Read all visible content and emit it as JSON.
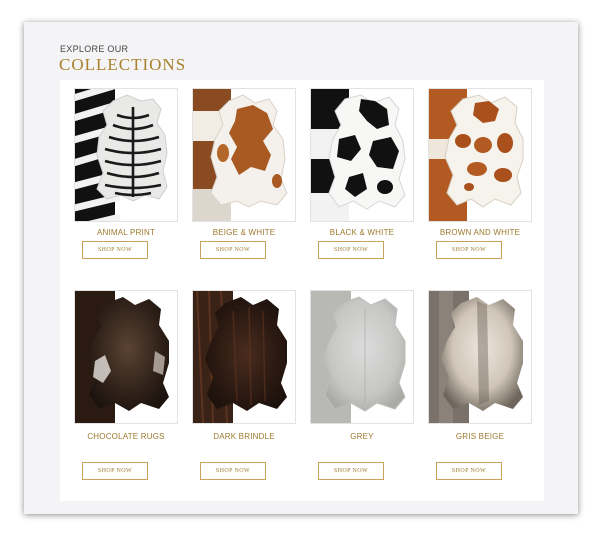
{
  "header": {
    "eyebrow": "EXPLORE OUR",
    "title": "COLLECTIONS"
  },
  "collections": [
    {
      "label": "ANIMAL PRINT",
      "button": "SHOP NOW",
      "image": "zebra-hide-rug"
    },
    {
      "label": "BEIGE & WHITE",
      "button": "SHOP NOW",
      "image": "beige-white-hide-rug"
    },
    {
      "label": "BLACK & WHITE",
      "button": "SHOP NOW",
      "image": "black-white-hide-rug"
    },
    {
      "label": "BROWN AND WHITE",
      "button": "SHOP NOW",
      "image": "brown-white-hide-rug"
    },
    {
      "label": "CHOCOLATE RUGS",
      "button": "SHOP NOW",
      "image": "chocolate-hide-rug"
    },
    {
      "label": "DARK BRINDLE",
      "button": "SHOP NOW",
      "image": "dark-brindle-hide-rug"
    },
    {
      "label": "GREY",
      "button": "SHOP NOW",
      "image": "grey-hide-rug"
    },
    {
      "label": "GRIS BEIGE",
      "button": "SHOP NOW",
      "image": "gris-beige-hide-rug"
    }
  ],
  "colors": {
    "accent": "#a8812c",
    "button_border": "#c9a35c",
    "card_bg": "#f4f4f6"
  }
}
